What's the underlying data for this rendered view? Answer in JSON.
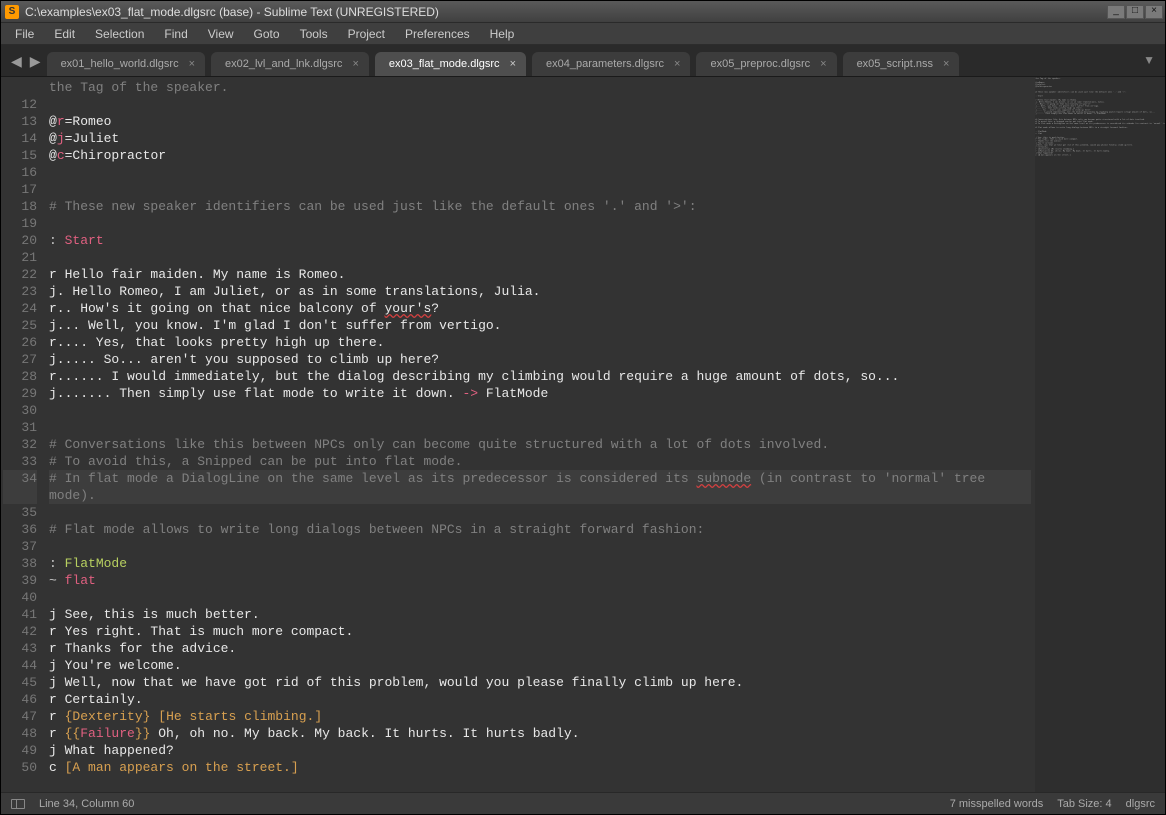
{
  "window": {
    "title": "C:\\examples\\ex03_flat_mode.dlgsrc (base) - Sublime Text (UNREGISTERED)"
  },
  "menu": {
    "items": [
      "File",
      "Edit",
      "Selection",
      "Find",
      "View",
      "Goto",
      "Tools",
      "Project",
      "Preferences",
      "Help"
    ]
  },
  "tabs": {
    "items": [
      {
        "label": "ex01_hello_world.dlgsrc",
        "active": false,
        "closable": true
      },
      {
        "label": "ex02_lvl_and_lnk.dlgsrc",
        "active": false,
        "closable": true
      },
      {
        "label": "ex03_flat_mode.dlgsrc",
        "active": true,
        "closable": true
      },
      {
        "label": "ex04_parameters.dlgsrc",
        "active": false,
        "closable": true
      },
      {
        "label": "ex05_preproc.dlgsrc",
        "active": false,
        "closable": true
      },
      {
        "label": "ex05_script.nss",
        "active": false,
        "closable": true
      }
    ]
  },
  "editor": {
    "first_line_no": 11,
    "lines": [
      {
        "n": "",
        "segs": [
          {
            "t": "the Tag of the speaker.",
            "c": "tok-comment"
          }
        ]
      },
      {
        "n": 12,
        "segs": []
      },
      {
        "n": 13,
        "segs": [
          {
            "t": "@",
            "c": ""
          },
          {
            "t": "r",
            "c": "tok-red"
          },
          {
            "t": "=Romeo",
            "c": ""
          }
        ]
      },
      {
        "n": 14,
        "segs": [
          {
            "t": "@",
            "c": ""
          },
          {
            "t": "j",
            "c": "tok-red"
          },
          {
            "t": "=Juliet",
            "c": ""
          }
        ]
      },
      {
        "n": 15,
        "segs": [
          {
            "t": "@",
            "c": ""
          },
          {
            "t": "c",
            "c": "tok-red"
          },
          {
            "t": "=Chiropractor",
            "c": ""
          }
        ]
      },
      {
        "n": 16,
        "segs": []
      },
      {
        "n": 17,
        "segs": []
      },
      {
        "n": 18,
        "segs": [
          {
            "t": "# These new speaker identifiers can be used just like the default ones '.' and '>':",
            "c": "tok-comment"
          }
        ]
      },
      {
        "n": 19,
        "segs": []
      },
      {
        "n": 20,
        "segs": [
          {
            "t": ": ",
            "c": "tok-punc"
          },
          {
            "t": "Start",
            "c": "tok-red"
          }
        ]
      },
      {
        "n": 21,
        "segs": []
      },
      {
        "n": 22,
        "segs": [
          {
            "t": "r Hello fair maiden. My name is Romeo.",
            "c": ""
          }
        ]
      },
      {
        "n": 23,
        "segs": [
          {
            "t": "j. Hello Romeo, I am Juliet, or as in some translations, Julia.",
            "c": ""
          }
        ]
      },
      {
        "n": 24,
        "segs": [
          {
            "t": "r.. How's it going on that nice balcony of ",
            "c": ""
          },
          {
            "t": "your's",
            "c": "err"
          },
          {
            "t": "?",
            "c": ""
          }
        ]
      },
      {
        "n": 25,
        "segs": [
          {
            "t": "j... Well, you know. I'm glad I don't suffer from vertigo.",
            "c": ""
          }
        ]
      },
      {
        "n": 26,
        "segs": [
          {
            "t": "r.... Yes, that looks pretty high up there.",
            "c": ""
          }
        ]
      },
      {
        "n": 27,
        "segs": [
          {
            "t": "j..... So... aren't you supposed to climb up here?",
            "c": ""
          }
        ]
      },
      {
        "n": 28,
        "segs": [
          {
            "t": "r...... I would immediately, but the dialog describing my climbing would require a huge amount of dots, so...",
            "c": ""
          }
        ]
      },
      {
        "n": 29,
        "segs": [
          {
            "t": "j....... Then simply use flat mode to write it down. ",
            "c": ""
          },
          {
            "t": "->",
            "c": "tok-red"
          },
          {
            "t": " FlatMode",
            "c": ""
          }
        ]
      },
      {
        "n": 30,
        "segs": []
      },
      {
        "n": 31,
        "segs": []
      },
      {
        "n": 32,
        "segs": [
          {
            "t": "# Conversations like this between NPCs only can become quite structured with a lot of dots involved.",
            "c": "tok-comment"
          }
        ]
      },
      {
        "n": 33,
        "segs": [
          {
            "t": "# To avoid this, a Snipped can be put into flat mode.",
            "c": "tok-comment"
          }
        ]
      },
      {
        "n": 34,
        "hl": true,
        "segs": [
          {
            "t": "# In flat mode a DialogLine on the same level as its predecessor is considered its ",
            "c": "tok-comment"
          },
          {
            "t": "subnode",
            "c": "tok-comment err"
          },
          {
            "t": " (in contrast to 'normal' tree mode).",
            "c": "tok-comment"
          }
        ]
      },
      {
        "n": 35,
        "segs": []
      },
      {
        "n": 36,
        "segs": [
          {
            "t": "# Flat mode allows to write long dialogs between NPCs in a straight forward fashion:",
            "c": "tok-comment"
          }
        ]
      },
      {
        "n": 37,
        "segs": []
      },
      {
        "n": 38,
        "segs": [
          {
            "t": ": ",
            "c": "tok-punc"
          },
          {
            "t": "FlatMode",
            "c": "tok-label"
          }
        ]
      },
      {
        "n": 39,
        "segs": [
          {
            "t": "~ ",
            "c": "tok-punc"
          },
          {
            "t": "flat",
            "c": "tok-red"
          }
        ]
      },
      {
        "n": 40,
        "segs": []
      },
      {
        "n": 41,
        "segs": [
          {
            "t": "j See, this is much better.",
            "c": ""
          }
        ]
      },
      {
        "n": 42,
        "segs": [
          {
            "t": "r Yes right. That is much more compact.",
            "c": ""
          }
        ]
      },
      {
        "n": 43,
        "segs": [
          {
            "t": "r Thanks for the advice.",
            "c": ""
          }
        ]
      },
      {
        "n": 44,
        "segs": [
          {
            "t": "j You're welcome.",
            "c": ""
          }
        ]
      },
      {
        "n": 45,
        "segs": [
          {
            "t": "j Well, now that we have got rid of this problem, would you please finally climb up here.",
            "c": ""
          }
        ]
      },
      {
        "n": 46,
        "segs": [
          {
            "t": "r Certainly.",
            "c": ""
          }
        ]
      },
      {
        "n": 47,
        "segs": [
          {
            "t": "r ",
            "c": ""
          },
          {
            "t": "{",
            "c": "tok-orange"
          },
          {
            "t": "Dexterity",
            "c": "tok-orange"
          },
          {
            "t": "}",
            "c": "tok-orange"
          },
          {
            "t": " ",
            "c": ""
          },
          {
            "t": "[",
            "c": "tok-orange"
          },
          {
            "t": "He starts climbing.",
            "c": "tok-orange"
          },
          {
            "t": "]",
            "c": "tok-orange"
          }
        ]
      },
      {
        "n": 48,
        "segs": [
          {
            "t": "r ",
            "c": ""
          },
          {
            "t": "{{",
            "c": "tok-orange"
          },
          {
            "t": "Failure",
            "c": "tok-red"
          },
          {
            "t": "}}",
            "c": "tok-orange"
          },
          {
            "t": " Oh, oh no. My back. My back. It hurts. It hurts badly.",
            "c": ""
          }
        ]
      },
      {
        "n": 49,
        "segs": [
          {
            "t": "j What happened?",
            "c": ""
          }
        ]
      },
      {
        "n": 50,
        "segs": [
          {
            "t": "c ",
            "c": ""
          },
          {
            "t": "[",
            "c": "tok-orange"
          },
          {
            "t": "A man appears on the street.",
            "c": "tok-orange"
          },
          {
            "t": "]",
            "c": "tok-orange"
          }
        ]
      }
    ]
  },
  "status": {
    "cursor": "Line 34, Column 60",
    "spell": "7 misspelled words",
    "tabsize": "Tab Size: 4",
    "syntax": "dlgsrc"
  }
}
